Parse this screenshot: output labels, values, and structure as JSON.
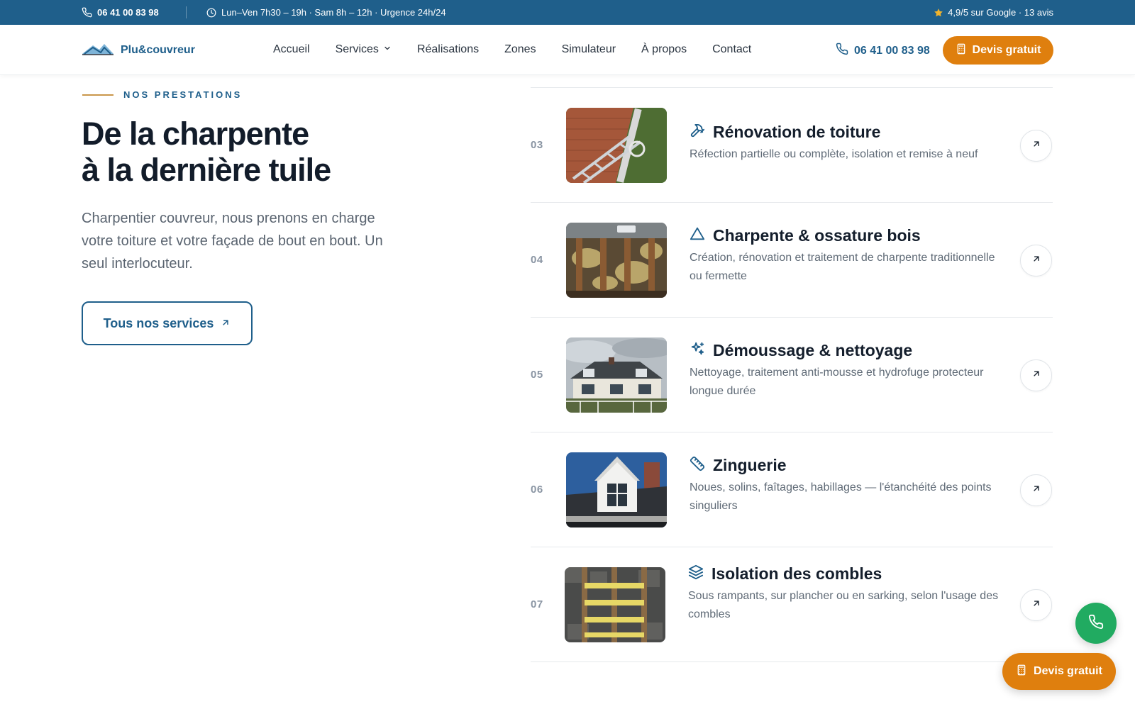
{
  "topbar": {
    "phone": "06 41 00 83 98",
    "hours": "Lun–Ven 7h30 – 19h · Sam 8h – 12h · Urgence 24h/24",
    "rating": "4,9/5 sur Google · 13 avis"
  },
  "header": {
    "logo_name": "Plu&couvreur",
    "nav": [
      {
        "label": "Accueil"
      },
      {
        "label": "Services"
      },
      {
        "label": "Réalisations"
      },
      {
        "label": "Zones"
      },
      {
        "label": "Simulateur"
      },
      {
        "label": "À propos"
      },
      {
        "label": "Contact"
      }
    ],
    "phone": "06 41 00 83 98",
    "cta": "Devis gratuit"
  },
  "intro": {
    "eyebrow": "NOS PRESTATIONS",
    "headline_line1": "De la charpente",
    "headline_line2": "à la dernière tuile",
    "text": "Charpentier couvreur, nous prenons en charge votre toiture et votre façade de bout en bout. Un seul interlocuteur.",
    "button": "Tous nos services"
  },
  "services": [
    {
      "num": "03",
      "title": "Rénovation de toiture",
      "desc": "Réfection partielle ou complète, isolation et remise à neuf",
      "icon": "hammer-icon"
    },
    {
      "num": "04",
      "title": "Charpente & ossature bois",
      "desc": "Création, rénovation et traitement de charpente traditionnelle ou fermette",
      "icon": "triangle-icon"
    },
    {
      "num": "05",
      "title": "Démoussage & nettoyage",
      "desc": "Nettoyage, traitement anti-mousse et hydrofuge protecteur longue durée",
      "icon": "sparkles-icon"
    },
    {
      "num": "06",
      "title": "Zinguerie",
      "desc": "Noues, solins, faîtages, habillages — l'étanchéité des points singuliers",
      "icon": "ruler-icon"
    },
    {
      "num": "07",
      "title": "Isolation des combles",
      "desc": "Sous rampants, sur plancher ou en sarking, selon l'usage des combles",
      "icon": "layers-icon"
    }
  ],
  "floating": {
    "devis": "Devis gratuit"
  },
  "colors": {
    "brand_blue": "#1f5f8b",
    "accent_orange": "#df7f0e",
    "call_green": "#21ab61"
  }
}
